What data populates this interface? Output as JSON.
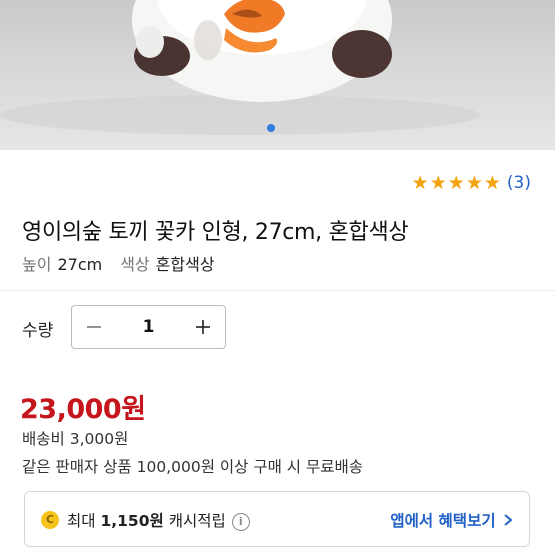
{
  "product": {
    "rating_stars": 5,
    "rating_count": "(3)",
    "title": "영이의숲 토끼 꽃카 인형, 27cm, 혼합색상",
    "specs": [
      {
        "key": "높이",
        "value": "27cm"
      },
      {
        "key": "색상",
        "value": "혼합색상"
      }
    ]
  },
  "gallery": {
    "slide_count": 2,
    "active_slide": 1
  },
  "quantity": {
    "label": "수량",
    "value": "1",
    "minus_icon": "minus-icon",
    "plus_icon": "plus-icon"
  },
  "pricing": {
    "price": "23,000원",
    "shipping": "배송비 3,000원",
    "free_shipping_note": "같은 판매자 상품 100,000원 이상 구매 시 무료배송"
  },
  "cashback": {
    "prefix": "최대",
    "amount": "1,150원",
    "suffix": "캐시적립",
    "link_label": "앱에서 혜택보기",
    "coin_icon": "coin-icon",
    "info_icon": "info-icon",
    "link_icon": "chevron-right-icon"
  },
  "colors": {
    "price": "#c4161c",
    "link": "#2262c6",
    "star": "#f2a30f",
    "active_dot": "#2f7dde"
  }
}
